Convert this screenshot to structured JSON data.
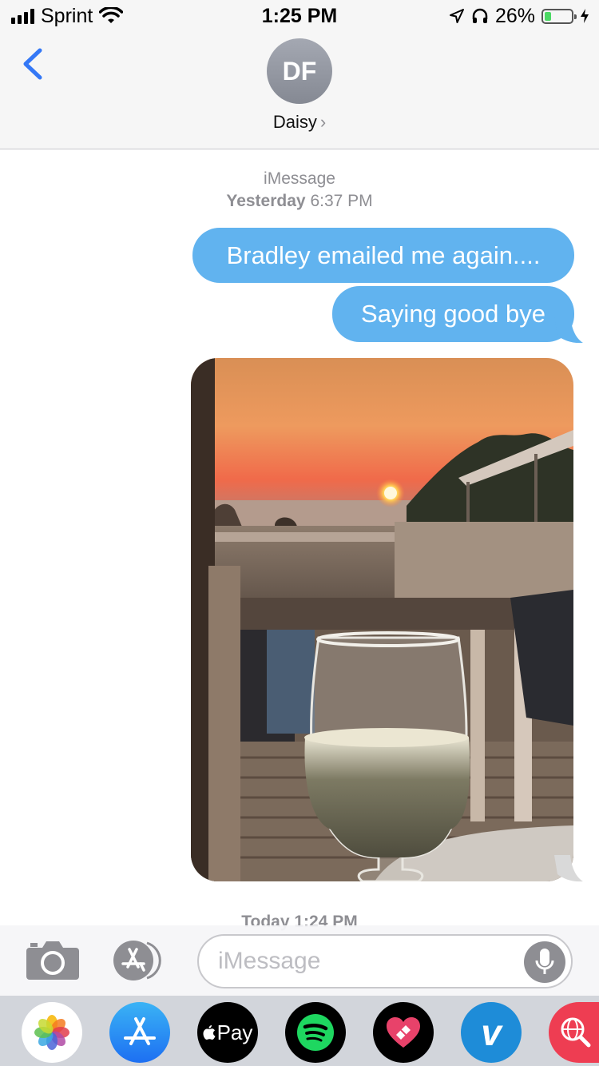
{
  "status_bar": {
    "carrier": "Sprint",
    "time": "1:25 PM",
    "battery_percent": "26%",
    "battery_level": 0.26,
    "icons": [
      "signal-icon",
      "wifi-icon",
      "location-icon",
      "headphones-icon",
      "battery-icon",
      "charging-icon"
    ]
  },
  "header": {
    "avatar_initials": "DF",
    "contact_name": "Daisy",
    "chevron": "›"
  },
  "conversation": {
    "service": "iMessage",
    "first_timestamp_day": "Yesterday",
    "first_timestamp_time": "6:37 PM",
    "messages": [
      {
        "text": "Bradley emailed me again....",
        "sender": "me"
      },
      {
        "text": "Saying good bye",
        "sender": "me"
      },
      {
        "type": "photo",
        "description_icon": "photo-attachment",
        "sender": "me"
      }
    ],
    "second_timestamp": "Today 1:24 PM"
  },
  "input": {
    "placeholder": "iMessage",
    "value": ""
  },
  "app_drawer": {
    "apps": [
      "photos-app-icon",
      "app-store-app-icon",
      "apple-pay-app-icon",
      "spotify-app-icon",
      "heart-app-icon",
      "venmo-app-icon",
      "web-search-app-icon"
    ],
    "apple_pay_label": "Pay",
    "venmo_label": "v"
  },
  "colors": {
    "bubble_blue": "#61b3ef",
    "ios_blue": "#3478f6",
    "gray_text": "#8e8e93"
  }
}
